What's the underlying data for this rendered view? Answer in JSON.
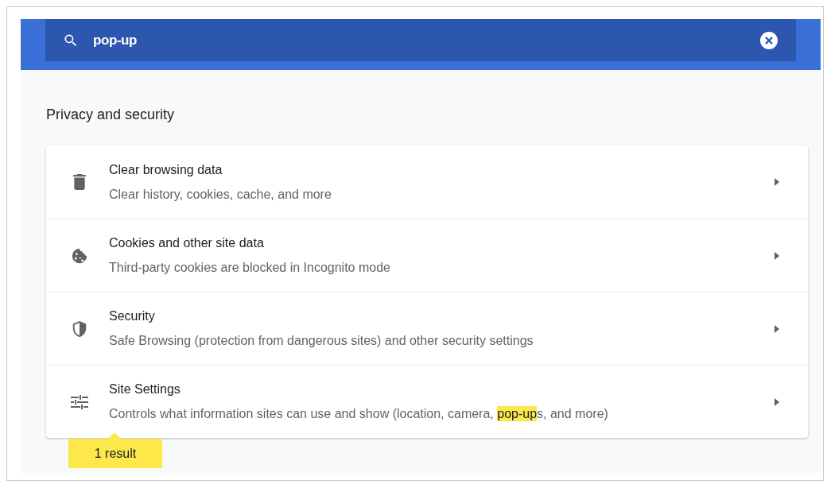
{
  "search": {
    "value": "pop-up"
  },
  "section_title": "Privacy and security",
  "rows": [
    {
      "kind": "trash",
      "title": "Clear browsing data",
      "description": [
        {
          "text": "Clear history, cookies, cache, and more",
          "highlighted": false
        }
      ]
    },
    {
      "kind": "cookie",
      "title": "Cookies and other site data",
      "description": [
        {
          "text": "Third-party cookies are blocked in Incognito mode",
          "highlighted": false
        }
      ]
    },
    {
      "kind": "shield",
      "title": "Security",
      "description": [
        {
          "text": "Safe Browsing (protection from dangerous sites) and other security settings",
          "highlighted": false
        }
      ]
    },
    {
      "kind": "sliders",
      "title": "Site Settings",
      "description": [
        {
          "text": "Controls what information sites can use and show (location, camera, ",
          "highlighted": false
        },
        {
          "text": "pop-up",
          "highlighted": true
        },
        {
          "text": "s, and more)",
          "highlighted": false
        }
      ]
    }
  ],
  "result_bubble": "1 result"
}
